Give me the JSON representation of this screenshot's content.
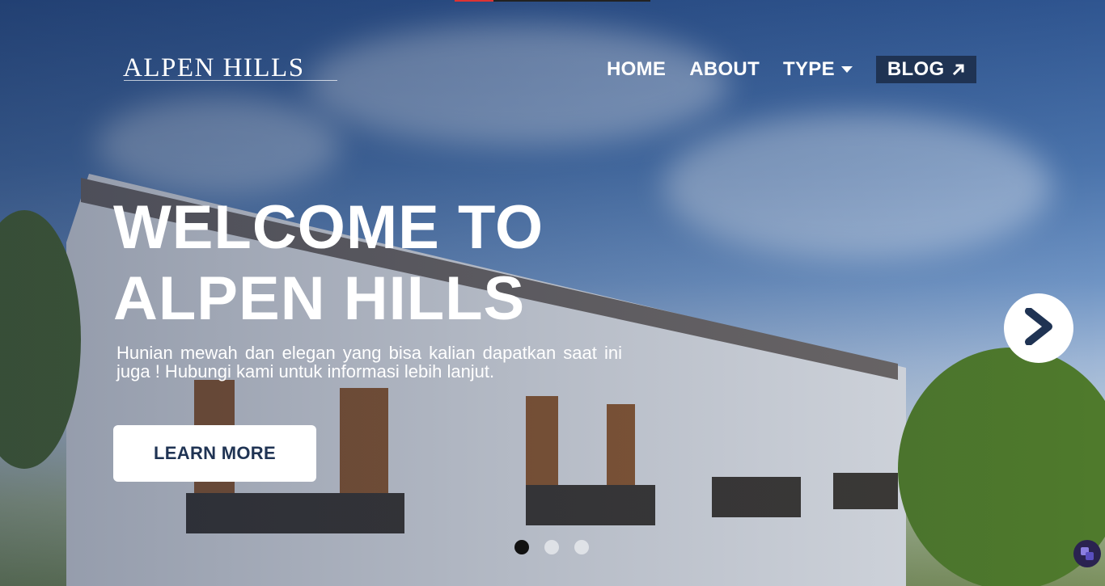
{
  "brand": {
    "logo_text": "ALPEN HILLS"
  },
  "nav": {
    "items": [
      {
        "label": "HOME"
      },
      {
        "label": "ABOUT"
      },
      {
        "label": "TYPE",
        "has_dropdown": true
      },
      {
        "label": "BLOG",
        "icon": "external-arrow-icon"
      }
    ]
  },
  "hero": {
    "headline_line1": "WELCOME TO",
    "headline_line2": "ALPEN HILLS",
    "subtext": "Hunian mewah dan elegan yang bisa kalian dapatkan saat ini juga ! Hubungi kami untuk informasi lebih lanjut.",
    "cta_label": "LEARN MORE"
  },
  "carousel": {
    "slides": 3,
    "active_index": 0,
    "next_icon": "chevron-right-icon"
  },
  "colors": {
    "accent": "#1f3353",
    "text": "#ffffff"
  }
}
